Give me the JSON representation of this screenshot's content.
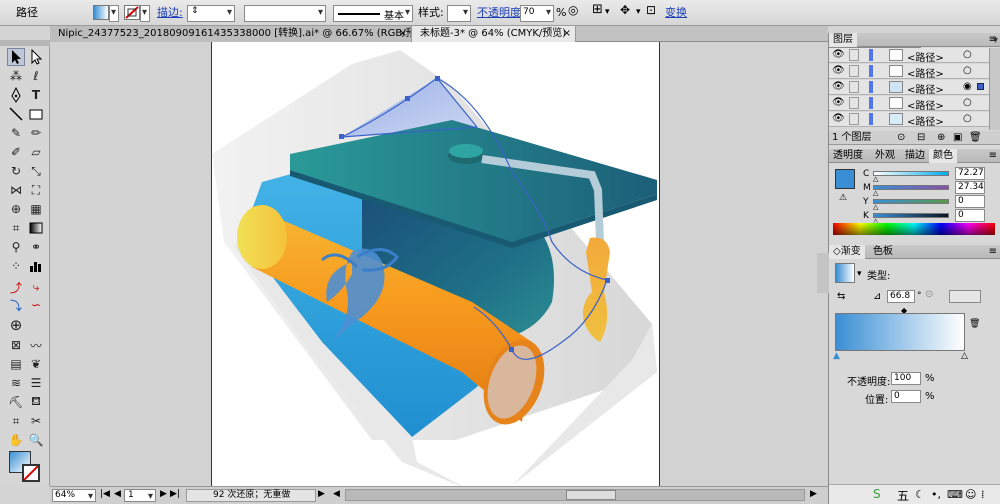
{
  "control_bar": {
    "object_type": "路径",
    "stroke_label": "描边:",
    "stroke_profile": "基本",
    "style_label": "样式:",
    "opacity_label": "不透明度:",
    "opacity_value": "70",
    "opacity_unit": "%",
    "transform_label": "变换",
    "fill_color": "#4a90d9"
  },
  "document_tabs": [
    {
      "label": "Nipic_24377523_20180909161435338000 [转换].ai* @ 66.67% (RGB/预览)",
      "active": false
    },
    {
      "label": "未标题-3* @ 64% (CMYK/预览)",
      "active": true
    }
  ],
  "status_bar": {
    "zoom": "64%",
    "page": "1",
    "history": "92 次还原；无重做"
  },
  "layers_panel": {
    "title": "图层",
    "items": [
      {
        "label": "<路径>",
        "selected": false
      },
      {
        "label": "<路径>",
        "selected": false
      },
      {
        "label": "<路径>",
        "selected": true
      },
      {
        "label": "<路径>",
        "selected": false
      },
      {
        "label": "<路径>",
        "selected": false
      }
    ],
    "count_label": "1 个图层"
  },
  "color_panel": {
    "tabs": [
      "透明度",
      "外观",
      "描边",
      "颜色"
    ],
    "active_tab": "颜色",
    "channels": [
      {
        "label": "C",
        "value": "72.27",
        "fraction": 0.7227
      },
      {
        "label": "M",
        "value": "27.34",
        "fraction": 0.2734
      },
      {
        "label": "Y",
        "value": "0",
        "fraction": 0
      },
      {
        "label": "K",
        "value": "0",
        "fraction": 0
      }
    ],
    "swatch_color": "#3a8fd4"
  },
  "gradient_panel": {
    "tabs": [
      "渐变",
      "色板"
    ],
    "active_tab": "渐变",
    "type_label": "类型:",
    "type_value": "线性",
    "angle_value": "66.8",
    "angle_unit": "°",
    "opacity_label": "不透明度:",
    "opacity_value": "100",
    "opacity_unit": "%",
    "location_label": "位置:",
    "location_value": "0",
    "location_unit": "%"
  },
  "taskbar": {
    "ime_label": "五"
  }
}
